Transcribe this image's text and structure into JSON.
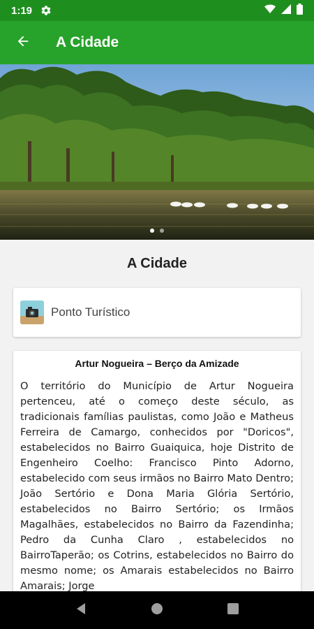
{
  "status_bar": {
    "time": "1:19"
  },
  "app_bar": {
    "title": "A Cidade"
  },
  "hero": {
    "slide_count": 2,
    "active_slide": 1
  },
  "section": {
    "title": "A Cidade"
  },
  "type_card": {
    "label": "Ponto Turístico"
  },
  "text_card": {
    "heading": "Artur Nogueira – Berço da Amizade",
    "body": "O território do Município de Artur Nogueira pertenceu, até o começo deste século, as tradicionais famílias paulistas, como João e Matheus Ferreira de Camargo, conhecidos por \"Doricos\", estabelecidos no Bairro Guaiquica, hoje Distrito de Engenheiro Coelho: Francisco Pinto Adorno, estabelecido com seus irmãos no Bairro Mato Dentro; João Sertório e Dona Maria Glória Sertório, estabelecidos no Bairro Sertório; os Irmãos Magalhães, estabelecidos no Bairro da Fazendinha; Pedro da Cunha Claro , estabelecidos no BairroTaperão; os Cotrins, estabelecidos no Bairro do mesmo nome; os Amarais estabelecidos no Bairro Amarais; Jorge"
  },
  "colors": {
    "status_bar": "#1e8f1f",
    "app_bar": "#27a22a",
    "background": "#f2f2f2"
  },
  "icons": {
    "status_bar": [
      "gear-icon",
      "wifi-icon",
      "signal-icon",
      "battery-icon"
    ],
    "app_bar": [
      "arrow-back-icon"
    ],
    "nav_bar": [
      "nav-back-icon",
      "nav-home-icon",
      "nav-recents-icon"
    ]
  }
}
